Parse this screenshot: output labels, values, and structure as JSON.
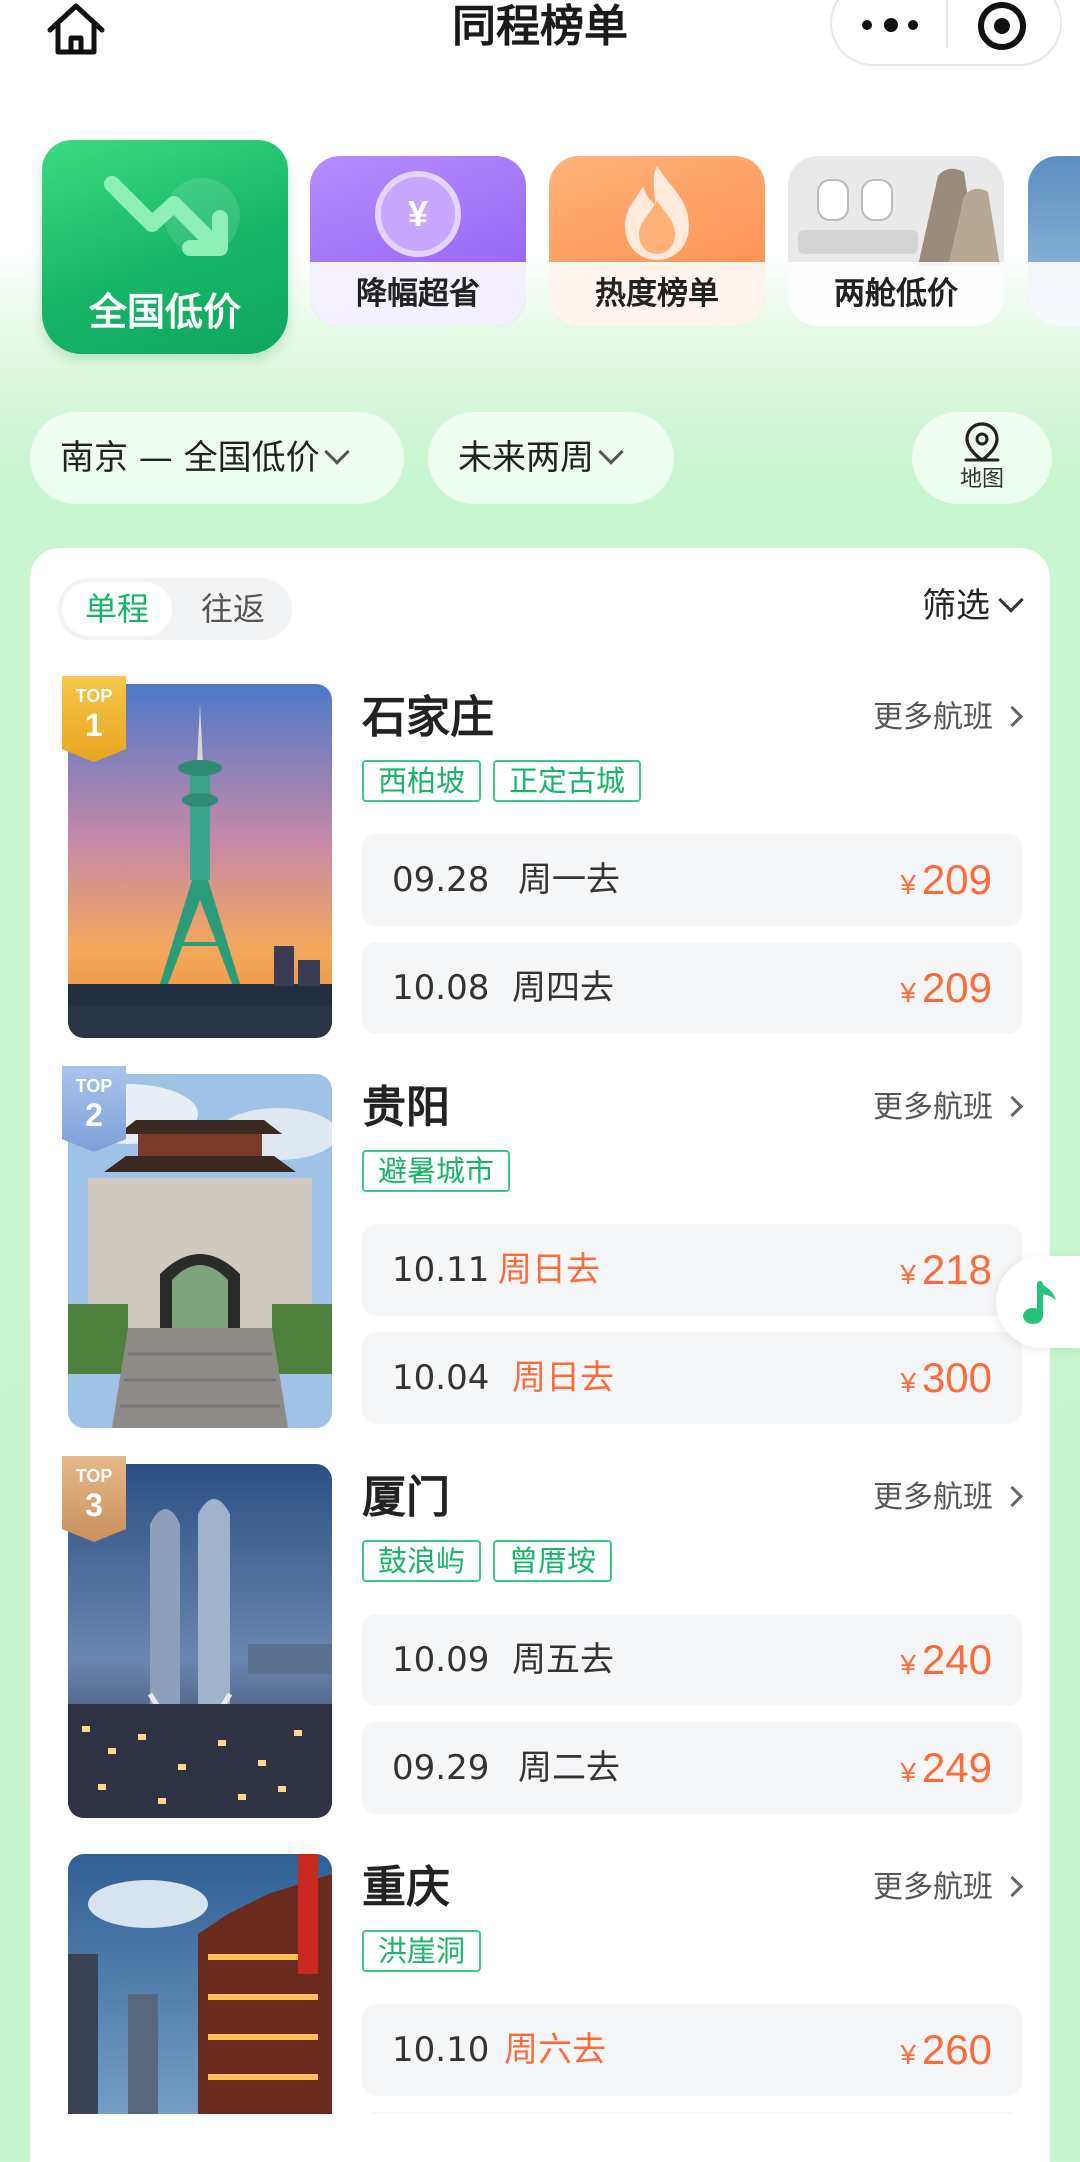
{
  "header": {
    "title": "同程榜单"
  },
  "categories": [
    {
      "label": "全国低价",
      "active": true
    },
    {
      "label": "降幅超省",
      "active": false
    },
    {
      "label": "热度榜单",
      "active": false
    },
    {
      "label": "两舱低价",
      "active": false
    }
  ],
  "filters": {
    "route": "南京 — 全国低价",
    "period": "未来两周",
    "map_label": "地图"
  },
  "trip_type": {
    "options": [
      "单程",
      "往返"
    ],
    "selected": "单程"
  },
  "filter_label": "筛选",
  "more_flights_label": "更多航班",
  "top_label": "TOP",
  "currency": "¥",
  "destinations": [
    {
      "rank": "1",
      "city": "石家庄",
      "tags": [
        "西柏坡",
        "正定古城"
      ],
      "fares": [
        {
          "date": "09.28",
          "weekday": "周一去",
          "price": "209",
          "weekend": false
        },
        {
          "date": "10.08",
          "weekday": "周四去",
          "price": "209",
          "weekend": false
        }
      ]
    },
    {
      "rank": "2",
      "city": "贵阳",
      "tags": [
        "避暑城市"
      ],
      "fares": [
        {
          "date": "10.11",
          "weekday": "周日去",
          "price": "218",
          "weekend": true
        },
        {
          "date": "10.04",
          "weekday": "周日去",
          "price": "300",
          "weekend": true
        }
      ]
    },
    {
      "rank": "3",
      "city": "厦门",
      "tags": [
        "鼓浪屿",
        "曾厝垵"
      ],
      "fares": [
        {
          "date": "10.09",
          "weekday": "周五去",
          "price": "240",
          "weekend": false
        },
        {
          "date": "09.29",
          "weekday": "周二去",
          "price": "249",
          "weekend": false
        }
      ]
    },
    {
      "rank": "",
      "city": "重庆",
      "tags": [
        "洪崖洞"
      ],
      "fares": [
        {
          "date": "10.10",
          "weekday": "周六去",
          "price": "260",
          "weekend": true
        }
      ]
    }
  ],
  "colors": {
    "accent_green": "#17b667",
    "price_orange": "#ff6a3a",
    "background_mint": "#c9f5cf"
  }
}
